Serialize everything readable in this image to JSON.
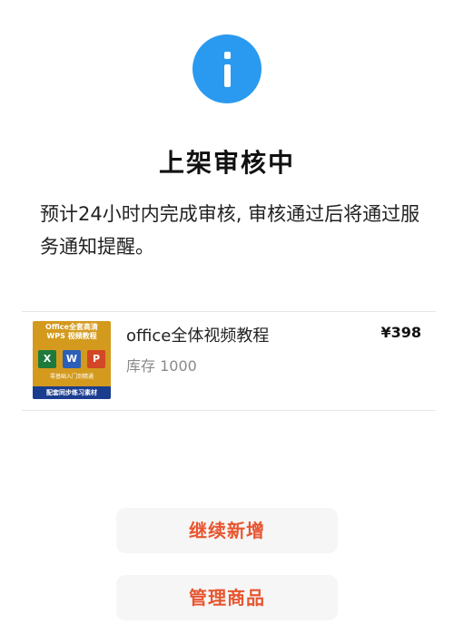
{
  "status": {
    "icon": "info-icon",
    "icon_color": "#2a9af0",
    "title": "上架审核中",
    "description": "预计24小时内完成审核, 审核通过后将通过服务通知提醒。"
  },
  "product": {
    "thumbnail": {
      "header_line1": "Office全套高清",
      "header_line2": "WPS 视频教程",
      "apps": [
        "Excel",
        "Word",
        "PPT"
      ],
      "subtitle": "零基础入门到精通",
      "footer": "配套同步练习素材",
      "bg_color": "#d39a1e",
      "footer_color": "#1a3d8f"
    },
    "name": "office全体视频教程",
    "stock_text": "库存 1000",
    "price": "¥398"
  },
  "actions": {
    "continue_label": "继续新增",
    "manage_label": "管理商品",
    "accent_color": "#e8552f"
  }
}
